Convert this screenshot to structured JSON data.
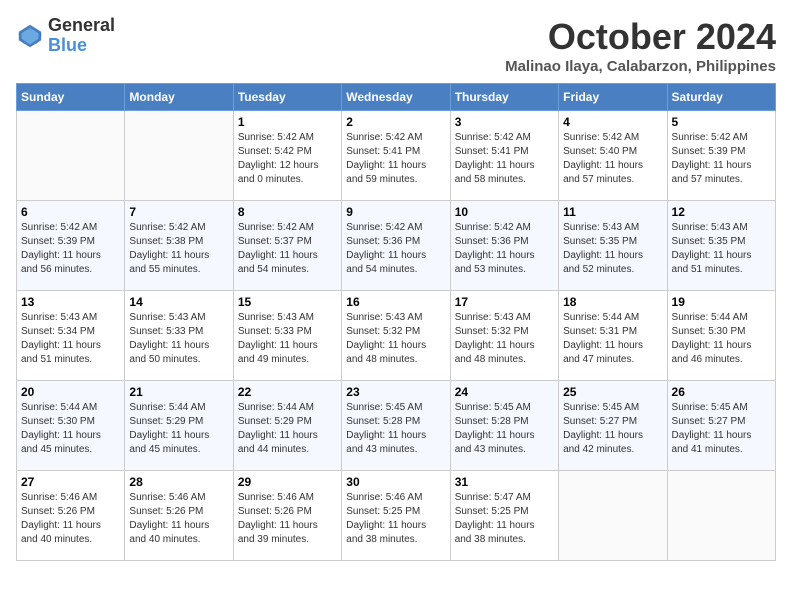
{
  "header": {
    "logo_line1": "General",
    "logo_line2": "Blue",
    "month": "October 2024",
    "location": "Malinao Ilaya, Calabarzon, Philippines"
  },
  "weekdays": [
    "Sunday",
    "Monday",
    "Tuesday",
    "Wednesday",
    "Thursday",
    "Friday",
    "Saturday"
  ],
  "weeks": [
    [
      {
        "day": "",
        "detail": ""
      },
      {
        "day": "",
        "detail": ""
      },
      {
        "day": "1",
        "detail": "Sunrise: 5:42 AM\nSunset: 5:42 PM\nDaylight: 12 hours\nand 0 minutes."
      },
      {
        "day": "2",
        "detail": "Sunrise: 5:42 AM\nSunset: 5:41 PM\nDaylight: 11 hours\nand 59 minutes."
      },
      {
        "day": "3",
        "detail": "Sunrise: 5:42 AM\nSunset: 5:41 PM\nDaylight: 11 hours\nand 58 minutes."
      },
      {
        "day": "4",
        "detail": "Sunrise: 5:42 AM\nSunset: 5:40 PM\nDaylight: 11 hours\nand 57 minutes."
      },
      {
        "day": "5",
        "detail": "Sunrise: 5:42 AM\nSunset: 5:39 PM\nDaylight: 11 hours\nand 57 minutes."
      }
    ],
    [
      {
        "day": "6",
        "detail": "Sunrise: 5:42 AM\nSunset: 5:39 PM\nDaylight: 11 hours\nand 56 minutes."
      },
      {
        "day": "7",
        "detail": "Sunrise: 5:42 AM\nSunset: 5:38 PM\nDaylight: 11 hours\nand 55 minutes."
      },
      {
        "day": "8",
        "detail": "Sunrise: 5:42 AM\nSunset: 5:37 PM\nDaylight: 11 hours\nand 54 minutes."
      },
      {
        "day": "9",
        "detail": "Sunrise: 5:42 AM\nSunset: 5:36 PM\nDaylight: 11 hours\nand 54 minutes."
      },
      {
        "day": "10",
        "detail": "Sunrise: 5:42 AM\nSunset: 5:36 PM\nDaylight: 11 hours\nand 53 minutes."
      },
      {
        "day": "11",
        "detail": "Sunrise: 5:43 AM\nSunset: 5:35 PM\nDaylight: 11 hours\nand 52 minutes."
      },
      {
        "day": "12",
        "detail": "Sunrise: 5:43 AM\nSunset: 5:35 PM\nDaylight: 11 hours\nand 51 minutes."
      }
    ],
    [
      {
        "day": "13",
        "detail": "Sunrise: 5:43 AM\nSunset: 5:34 PM\nDaylight: 11 hours\nand 51 minutes."
      },
      {
        "day": "14",
        "detail": "Sunrise: 5:43 AM\nSunset: 5:33 PM\nDaylight: 11 hours\nand 50 minutes."
      },
      {
        "day": "15",
        "detail": "Sunrise: 5:43 AM\nSunset: 5:33 PM\nDaylight: 11 hours\nand 49 minutes."
      },
      {
        "day": "16",
        "detail": "Sunrise: 5:43 AM\nSunset: 5:32 PM\nDaylight: 11 hours\nand 48 minutes."
      },
      {
        "day": "17",
        "detail": "Sunrise: 5:43 AM\nSunset: 5:32 PM\nDaylight: 11 hours\nand 48 minutes."
      },
      {
        "day": "18",
        "detail": "Sunrise: 5:44 AM\nSunset: 5:31 PM\nDaylight: 11 hours\nand 47 minutes."
      },
      {
        "day": "19",
        "detail": "Sunrise: 5:44 AM\nSunset: 5:30 PM\nDaylight: 11 hours\nand 46 minutes."
      }
    ],
    [
      {
        "day": "20",
        "detail": "Sunrise: 5:44 AM\nSunset: 5:30 PM\nDaylight: 11 hours\nand 45 minutes."
      },
      {
        "day": "21",
        "detail": "Sunrise: 5:44 AM\nSunset: 5:29 PM\nDaylight: 11 hours\nand 45 minutes."
      },
      {
        "day": "22",
        "detail": "Sunrise: 5:44 AM\nSunset: 5:29 PM\nDaylight: 11 hours\nand 44 minutes."
      },
      {
        "day": "23",
        "detail": "Sunrise: 5:45 AM\nSunset: 5:28 PM\nDaylight: 11 hours\nand 43 minutes."
      },
      {
        "day": "24",
        "detail": "Sunrise: 5:45 AM\nSunset: 5:28 PM\nDaylight: 11 hours\nand 43 minutes."
      },
      {
        "day": "25",
        "detail": "Sunrise: 5:45 AM\nSunset: 5:27 PM\nDaylight: 11 hours\nand 42 minutes."
      },
      {
        "day": "26",
        "detail": "Sunrise: 5:45 AM\nSunset: 5:27 PM\nDaylight: 11 hours\nand 41 minutes."
      }
    ],
    [
      {
        "day": "27",
        "detail": "Sunrise: 5:46 AM\nSunset: 5:26 PM\nDaylight: 11 hours\nand 40 minutes."
      },
      {
        "day": "28",
        "detail": "Sunrise: 5:46 AM\nSunset: 5:26 PM\nDaylight: 11 hours\nand 40 minutes."
      },
      {
        "day": "29",
        "detail": "Sunrise: 5:46 AM\nSunset: 5:26 PM\nDaylight: 11 hours\nand 39 minutes."
      },
      {
        "day": "30",
        "detail": "Sunrise: 5:46 AM\nSunset: 5:25 PM\nDaylight: 11 hours\nand 38 minutes."
      },
      {
        "day": "31",
        "detail": "Sunrise: 5:47 AM\nSunset: 5:25 PM\nDaylight: 11 hours\nand 38 minutes."
      },
      {
        "day": "",
        "detail": ""
      },
      {
        "day": "",
        "detail": ""
      }
    ]
  ]
}
